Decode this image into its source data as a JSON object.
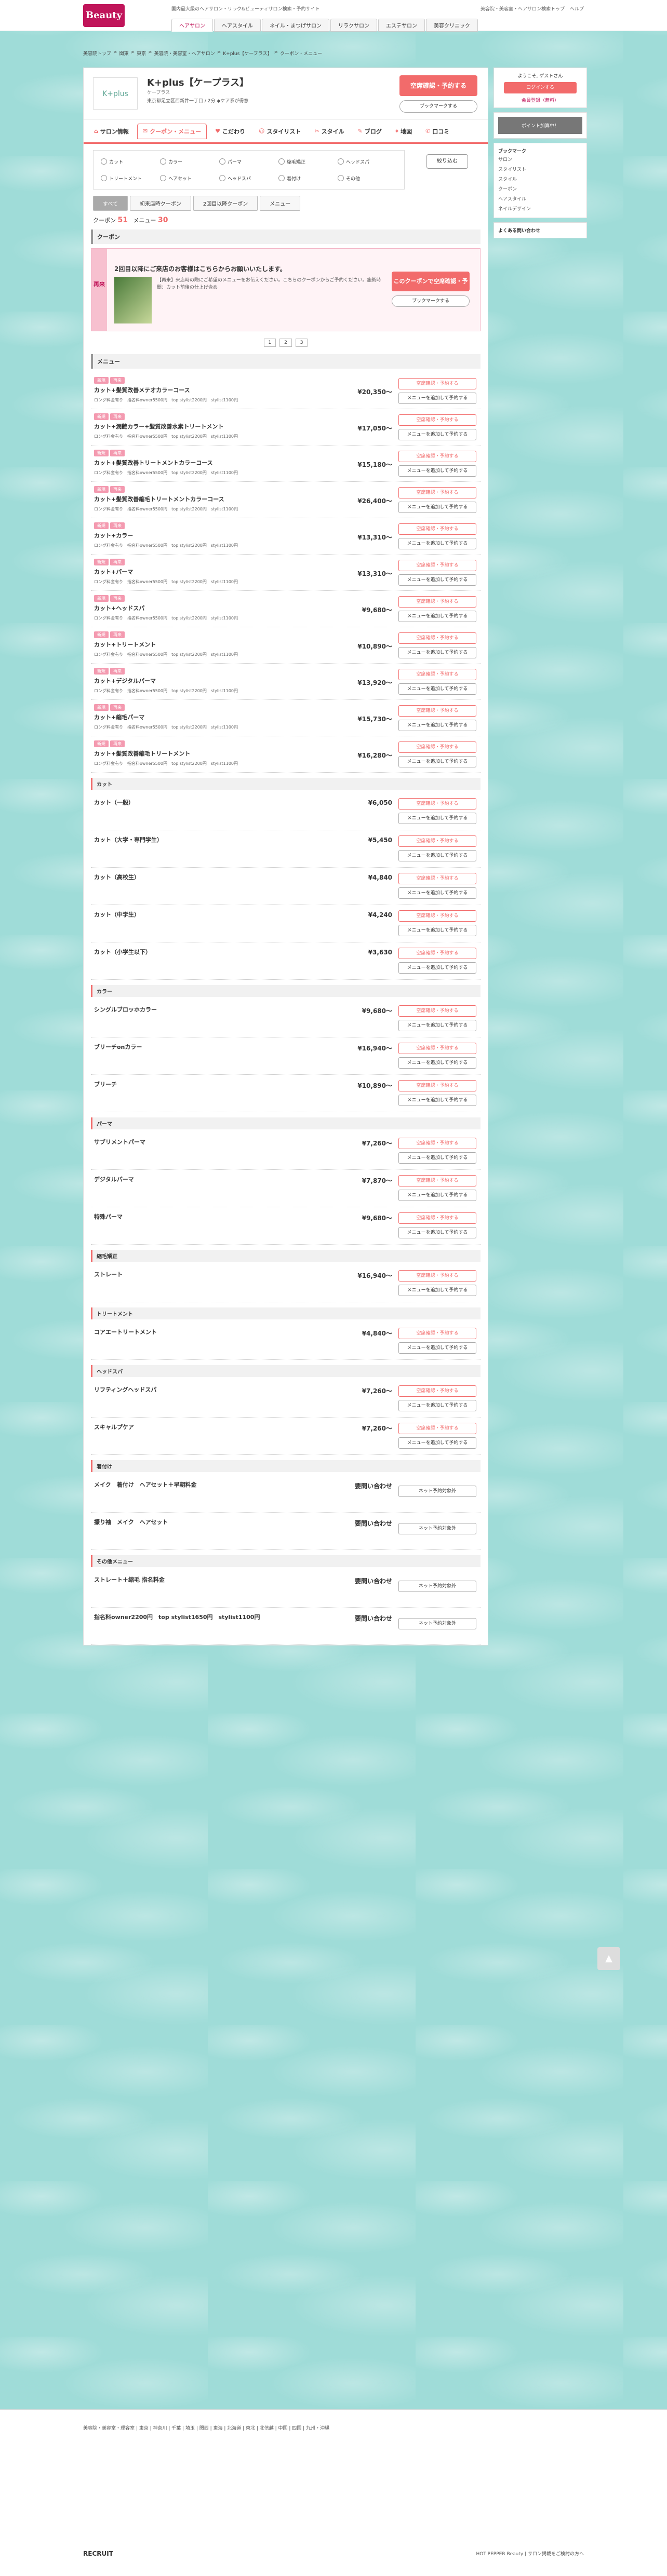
{
  "header": {
    "logo": "Beauty",
    "top_links": [
      "国内最大級のヘアサロン・リラク&ビューティサロン検索・予約サイト"
    ],
    "right_links": [
      "美容院・美容室・ヘアサロン検索トップ",
      "ヘルプ"
    ],
    "nav": [
      "ヘアサロン",
      "ヘアスタイル",
      "ネイル・まつげサロン",
      "リラクサロン",
      "エステサロン",
      "美容クリニック"
    ]
  },
  "breadcrumb": [
    "美容院トップ",
    "関東",
    "東京",
    "美容院・美容室・ヘアサロン",
    "K+plus【ケープラス】",
    "クーポン・メニュー"
  ],
  "salon": {
    "name": "K+plus【ケープラス】",
    "kana": "ケープラス",
    "logo_text": "K+plus",
    "address": "東京都足立区西新井一丁目 / 2分 ◆ケア系が得意",
    "reserve_label": "空席確認・予約する",
    "bookmark_label": "ブックマークする",
    "staff_label": "スタッフ空き状況を見る"
  },
  "tabs": [
    {
      "label": "サロン情報",
      "icon": "home-icon"
    },
    {
      "label": "クーポン・メニュー",
      "icon": "coupon-icon",
      "active": true
    },
    {
      "label": "こだわり",
      "icon": "heart-icon"
    },
    {
      "label": "スタイリスト",
      "icon": "person-icon"
    },
    {
      "label": "スタイル",
      "icon": "scissors-icon"
    },
    {
      "label": "ブログ",
      "icon": "pen-icon"
    },
    {
      "label": "地図",
      "icon": "map-icon"
    },
    {
      "label": "口コミ",
      "icon": "chat-icon"
    }
  ],
  "filters": [
    "カット",
    "カラー",
    "パーマ",
    "縮毛矯正",
    "ヘッドスパ",
    "トリートメント",
    "ヘアセット",
    "ヘッドスパ",
    "着付け",
    "その他"
  ],
  "filter_button": "絞り込む",
  "coupon_tabs": [
    "すべて",
    "初来店時クーポン",
    "2回目以降クーポン",
    "メニュー"
  ],
  "counts": {
    "coupon_label": "クーポン",
    "coupon": "51",
    "menu_label": "メニュー",
    "menu": "30"
  },
  "sections": {
    "coupon": "クーポン",
    "menu": "メニュー"
  },
  "featured_coupon": {
    "label": "再来",
    "title": "2回目以降にご来店のお客様はこちらからお願いいたします。",
    "desc": "【再来】来店時の際にご希望のメニューをお伝えください。こちらのクーポンからご予約ください。施術時間：カット前後の仕上げ含め",
    "button": "このクーポンで空席確認・予約する",
    "bookmark": "ブックマークする"
  },
  "pager": [
    "1",
    "2",
    "3"
  ],
  "menu_items": [
    {
      "tags": [
        "新規",
        "再来"
      ],
      "name": "カット+髪質改善メテオカラーコース",
      "price": "¥20,350〜",
      "desc": "ロング料金有り　指名料owner5500円　top stylist2200円　stylist1100円"
    },
    {
      "tags": [
        "新規",
        "再来"
      ],
      "name": "カット+潤艶カラー+髪質改善水素トリートメント",
      "price": "¥17,050〜",
      "desc": "ロング料金有り　指名料owner5500円　top stylist2200円　stylist1100円"
    },
    {
      "tags": [
        "新規",
        "再来"
      ],
      "name": "カット+髪質改善トリートメントカラーコース",
      "price": "¥15,180〜",
      "desc": "ロング料金有り　指名料owner5500円　top stylist2200円　stylist1100円"
    },
    {
      "tags": [
        "新規",
        "再来"
      ],
      "name": "カット+髪質改善縮毛トリートメントカラーコース",
      "price": "¥26,400〜",
      "desc": "ロング料金有り　指名料owner5500円　top stylist2200円　stylist1100円"
    },
    {
      "tags": [
        "新規",
        "再来"
      ],
      "name": "カット+カラー",
      "price": "¥13,310〜",
      "desc": "ロング料金有り　指名料owner5500円　top stylist2200円　stylist1100円"
    },
    {
      "tags": [
        "新規",
        "再来"
      ],
      "name": "カット+パーマ",
      "price": "¥13,310〜",
      "desc": "ロング料金有り　指名料owner5500円　top stylist2200円　stylist1100円"
    },
    {
      "tags": [
        "新規",
        "再来"
      ],
      "name": "カット+ヘッドスパ",
      "price": "¥9,680〜",
      "desc": "ロング料金有り　指名料owner5500円　top stylist2200円　stylist1100円"
    },
    {
      "tags": [
        "新規",
        "再来"
      ],
      "name": "カット+トリートメント",
      "price": "¥10,890〜",
      "desc": "ロング料金有り　指名料owner5500円　top stylist2200円　stylist1100円"
    },
    {
      "tags": [
        "新規",
        "再来"
      ],
      "name": "カット+デジタルパーマ",
      "price": "¥13,920〜",
      "desc": "ロング料金有り　指名料owner5500円　top stylist2200円　stylist1100円"
    },
    {
      "tags": [
        "新規",
        "再来"
      ],
      "name": "カット+縮毛パーマ",
      "price": "¥15,730〜",
      "desc": "ロング料金有り　指名料owner5500円　top stylist2200円　stylist1100円"
    },
    {
      "tags": [
        "新規",
        "再来"
      ],
      "name": "カット+髪質改善縮毛トリートメント",
      "price": "¥16,280〜",
      "desc": "ロング料金有り　指名料owner5500円　top stylist2200円　stylist1100円"
    }
  ],
  "categories": [
    {
      "title": "カット",
      "items": [
        {
          "name": "カット（一般）",
          "price": "¥6,050"
        },
        {
          "name": "カット（大学・専門学生）",
          "price": "¥5,450"
        },
        {
          "name": "カット（高校生）",
          "price": "¥4,840"
        },
        {
          "name": "カット（中学生）",
          "price": "¥4,240"
        },
        {
          "name": "カット（小学生以下）",
          "price": "¥3,630"
        }
      ]
    },
    {
      "title": "カラー",
      "items": [
        {
          "name": "シングルブロッホカラー",
          "price": "¥9,680〜"
        },
        {
          "name": "ブリーチonカラー",
          "price": "¥16,940〜"
        },
        {
          "name": "ブリーチ",
          "price": "¥10,890〜"
        }
      ]
    },
    {
      "title": "パーマ",
      "items": [
        {
          "name": "サブリメントパーマ",
          "price": "¥7,260〜"
        },
        {
          "name": "デジタルパーマ",
          "price": "¥7,870〜"
        },
        {
          "name": "特殊パーマ",
          "price": "¥9,680〜"
        }
      ]
    },
    {
      "title": "縮毛矯正",
      "items": [
        {
          "name": "ストレート",
          "price": "¥16,940〜"
        }
      ]
    },
    {
      "title": "トリートメント",
      "items": [
        {
          "name": "コアエートリートメント",
          "price": "¥4,840〜"
        }
      ]
    },
    {
      "title": "ヘッドスパ",
      "items": [
        {
          "name": "リフティングヘッドスパ",
          "price": "¥7,260〜"
        },
        {
          "name": "スキャルプケア",
          "price": "¥7,260〜"
        }
      ]
    },
    {
      "title": "着付け",
      "items": [
        {
          "name": "メイク　着付け　ヘアセット＋早朝料金",
          "price": "要問い合わせ"
        },
        {
          "name": "振り袖　メイク　ヘアセット",
          "price": "要問い合わせ"
        }
      ]
    },
    {
      "title": "その他メニュー",
      "items": [
        {
          "name": "ストレート＋縮毛 指名料金",
          "price": "要問い合わせ"
        },
        {
          "name": "指名料owner2200円　top stylist1650円　stylist1100円",
          "price": "要問い合わせ"
        }
      ]
    }
  ],
  "buttons": {
    "reserve": "空席確認・予約する",
    "add_menu": "メニューを追加して予約する",
    "net_na": "ネット予約対象外"
  },
  "sidebar": {
    "greeting": "ようこそ, ゲストさん",
    "login": "ログインする",
    "register": "会員登録（無料）",
    "promo": "ポイント加算中！",
    "bookmark_title": "ブックマーク",
    "bookmark_items": [
      "サロン",
      "スタイリスト",
      "スタイル",
      "クーポン",
      "ヘアスタイル",
      "ネイルデザイン"
    ],
    "faq_title": "よくある問い合わせ"
  },
  "footer": {
    "links": "美容院・美容室・理容室 | 東京 | 神奈川 | 千葉 | 埼玉 | 関西 | 東海 | 北海道 | 東北 | 北信越 | 中国 | 四国 | 九州・沖縄",
    "recruit": "RECRUIT",
    "right": "HOT PEPPER Beauty | サロン掲載をご検討の方へ"
  }
}
